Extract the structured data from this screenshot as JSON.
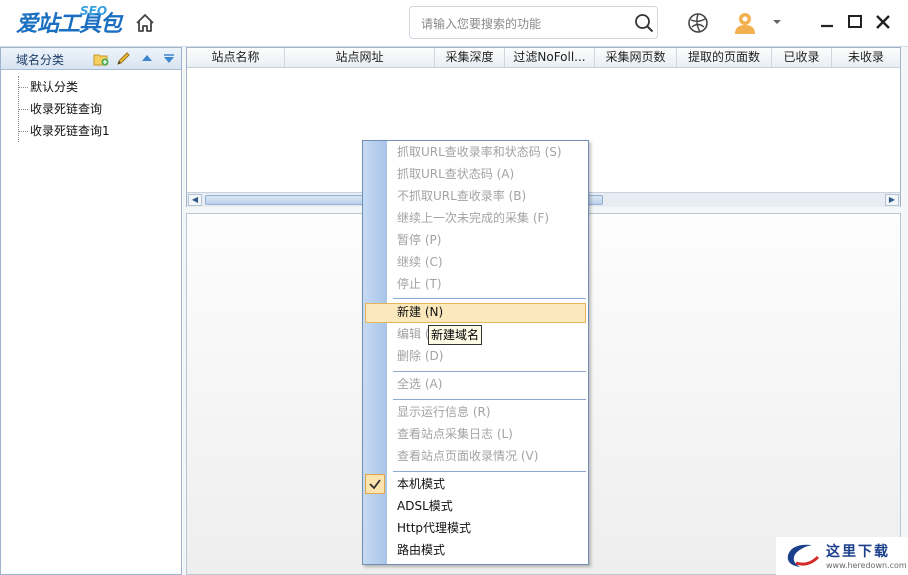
{
  "app": {
    "logo_text": "爱站工具包",
    "logo_badge": "SEO"
  },
  "search": {
    "placeholder": "请输入您要搜索的功能"
  },
  "left_panel": {
    "title": "域名分类",
    "items": [
      "默认分类",
      "收录死链查询",
      "收录死链查询1"
    ]
  },
  "table": {
    "columns": [
      "站点名称",
      "站点网址",
      "采集深度",
      "过滤NoFoll...",
      "采集网页数",
      "提取的页面数",
      "已收录",
      "未收录"
    ]
  },
  "context_menu": {
    "items": [
      {
        "label": "抓取URL查收录率和状态码 (S)",
        "enabled": false
      },
      {
        "label": "抓取URL查状态码 (A)",
        "enabled": false
      },
      {
        "label": "不抓取URL查收录率 (B)",
        "enabled": false
      },
      {
        "label": "继续上一次未完成的采集 (F)",
        "enabled": false
      },
      {
        "label": "暂停 (P)",
        "enabled": false
      },
      {
        "label": "继续 (C)",
        "enabled": false
      },
      {
        "label": "停止 (T)",
        "enabled": false
      },
      {
        "label": "新建 (N)",
        "enabled": true,
        "highlighted": true
      },
      {
        "label": "编辑 (E)",
        "enabled": false
      },
      {
        "label": "删除 (D)",
        "enabled": false
      },
      {
        "label": "全选 (A)",
        "enabled": false
      },
      {
        "label": "显示运行信息 (R)",
        "enabled": false
      },
      {
        "label": "查看站点采集日志 (L)",
        "enabled": false
      },
      {
        "label": "查看站点页面收录情况 (V)",
        "enabled": false
      },
      {
        "label": "本机模式",
        "enabled": true,
        "checked": true
      },
      {
        "label": "ADSL模式",
        "enabled": true
      },
      {
        "label": "Http代理模式",
        "enabled": true
      },
      {
        "label": "路由模式",
        "enabled": true
      }
    ]
  },
  "tooltip": "新建域名",
  "watermark": {
    "text": "这里下载",
    "url": "www.heredown.com"
  },
  "colors": {
    "brand": "#1a6fc0",
    "accent": "#f0a030",
    "menu_highlight": "#fbe9bd"
  }
}
